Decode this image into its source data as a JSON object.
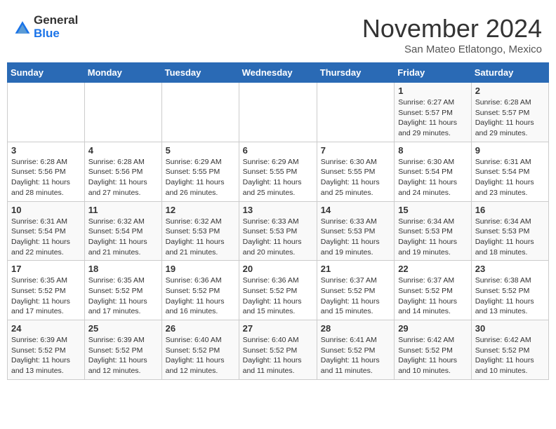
{
  "header": {
    "logo_general": "General",
    "logo_blue": "Blue",
    "month_title": "November 2024",
    "location": "San Mateo Etlatongo, Mexico"
  },
  "calendar": {
    "days_of_week": [
      "Sunday",
      "Monday",
      "Tuesday",
      "Wednesday",
      "Thursday",
      "Friday",
      "Saturday"
    ],
    "weeks": [
      [
        {
          "day": "",
          "info": ""
        },
        {
          "day": "",
          "info": ""
        },
        {
          "day": "",
          "info": ""
        },
        {
          "day": "",
          "info": ""
        },
        {
          "day": "",
          "info": ""
        },
        {
          "day": "1",
          "info": "Sunrise: 6:27 AM\nSunset: 5:57 PM\nDaylight: 11 hours and 29 minutes."
        },
        {
          "day": "2",
          "info": "Sunrise: 6:28 AM\nSunset: 5:57 PM\nDaylight: 11 hours and 29 minutes."
        }
      ],
      [
        {
          "day": "3",
          "info": "Sunrise: 6:28 AM\nSunset: 5:56 PM\nDaylight: 11 hours and 28 minutes."
        },
        {
          "day": "4",
          "info": "Sunrise: 6:28 AM\nSunset: 5:56 PM\nDaylight: 11 hours and 27 minutes."
        },
        {
          "day": "5",
          "info": "Sunrise: 6:29 AM\nSunset: 5:55 PM\nDaylight: 11 hours and 26 minutes."
        },
        {
          "day": "6",
          "info": "Sunrise: 6:29 AM\nSunset: 5:55 PM\nDaylight: 11 hours and 25 minutes."
        },
        {
          "day": "7",
          "info": "Sunrise: 6:30 AM\nSunset: 5:55 PM\nDaylight: 11 hours and 25 minutes."
        },
        {
          "day": "8",
          "info": "Sunrise: 6:30 AM\nSunset: 5:54 PM\nDaylight: 11 hours and 24 minutes."
        },
        {
          "day": "9",
          "info": "Sunrise: 6:31 AM\nSunset: 5:54 PM\nDaylight: 11 hours and 23 minutes."
        }
      ],
      [
        {
          "day": "10",
          "info": "Sunrise: 6:31 AM\nSunset: 5:54 PM\nDaylight: 11 hours and 22 minutes."
        },
        {
          "day": "11",
          "info": "Sunrise: 6:32 AM\nSunset: 5:54 PM\nDaylight: 11 hours and 21 minutes."
        },
        {
          "day": "12",
          "info": "Sunrise: 6:32 AM\nSunset: 5:53 PM\nDaylight: 11 hours and 21 minutes."
        },
        {
          "day": "13",
          "info": "Sunrise: 6:33 AM\nSunset: 5:53 PM\nDaylight: 11 hours and 20 minutes."
        },
        {
          "day": "14",
          "info": "Sunrise: 6:33 AM\nSunset: 5:53 PM\nDaylight: 11 hours and 19 minutes."
        },
        {
          "day": "15",
          "info": "Sunrise: 6:34 AM\nSunset: 5:53 PM\nDaylight: 11 hours and 19 minutes."
        },
        {
          "day": "16",
          "info": "Sunrise: 6:34 AM\nSunset: 5:53 PM\nDaylight: 11 hours and 18 minutes."
        }
      ],
      [
        {
          "day": "17",
          "info": "Sunrise: 6:35 AM\nSunset: 5:52 PM\nDaylight: 11 hours and 17 minutes."
        },
        {
          "day": "18",
          "info": "Sunrise: 6:35 AM\nSunset: 5:52 PM\nDaylight: 11 hours and 17 minutes."
        },
        {
          "day": "19",
          "info": "Sunrise: 6:36 AM\nSunset: 5:52 PM\nDaylight: 11 hours and 16 minutes."
        },
        {
          "day": "20",
          "info": "Sunrise: 6:36 AM\nSunset: 5:52 PM\nDaylight: 11 hours and 15 minutes."
        },
        {
          "day": "21",
          "info": "Sunrise: 6:37 AM\nSunset: 5:52 PM\nDaylight: 11 hours and 15 minutes."
        },
        {
          "day": "22",
          "info": "Sunrise: 6:37 AM\nSunset: 5:52 PM\nDaylight: 11 hours and 14 minutes."
        },
        {
          "day": "23",
          "info": "Sunrise: 6:38 AM\nSunset: 5:52 PM\nDaylight: 11 hours and 13 minutes."
        }
      ],
      [
        {
          "day": "24",
          "info": "Sunrise: 6:39 AM\nSunset: 5:52 PM\nDaylight: 11 hours and 13 minutes."
        },
        {
          "day": "25",
          "info": "Sunrise: 6:39 AM\nSunset: 5:52 PM\nDaylight: 11 hours and 12 minutes."
        },
        {
          "day": "26",
          "info": "Sunrise: 6:40 AM\nSunset: 5:52 PM\nDaylight: 11 hours and 12 minutes."
        },
        {
          "day": "27",
          "info": "Sunrise: 6:40 AM\nSunset: 5:52 PM\nDaylight: 11 hours and 11 minutes."
        },
        {
          "day": "28",
          "info": "Sunrise: 6:41 AM\nSunset: 5:52 PM\nDaylight: 11 hours and 11 minutes."
        },
        {
          "day": "29",
          "info": "Sunrise: 6:42 AM\nSunset: 5:52 PM\nDaylight: 11 hours and 10 minutes."
        },
        {
          "day": "30",
          "info": "Sunrise: 6:42 AM\nSunset: 5:52 PM\nDaylight: 11 hours and 10 minutes."
        }
      ]
    ]
  }
}
